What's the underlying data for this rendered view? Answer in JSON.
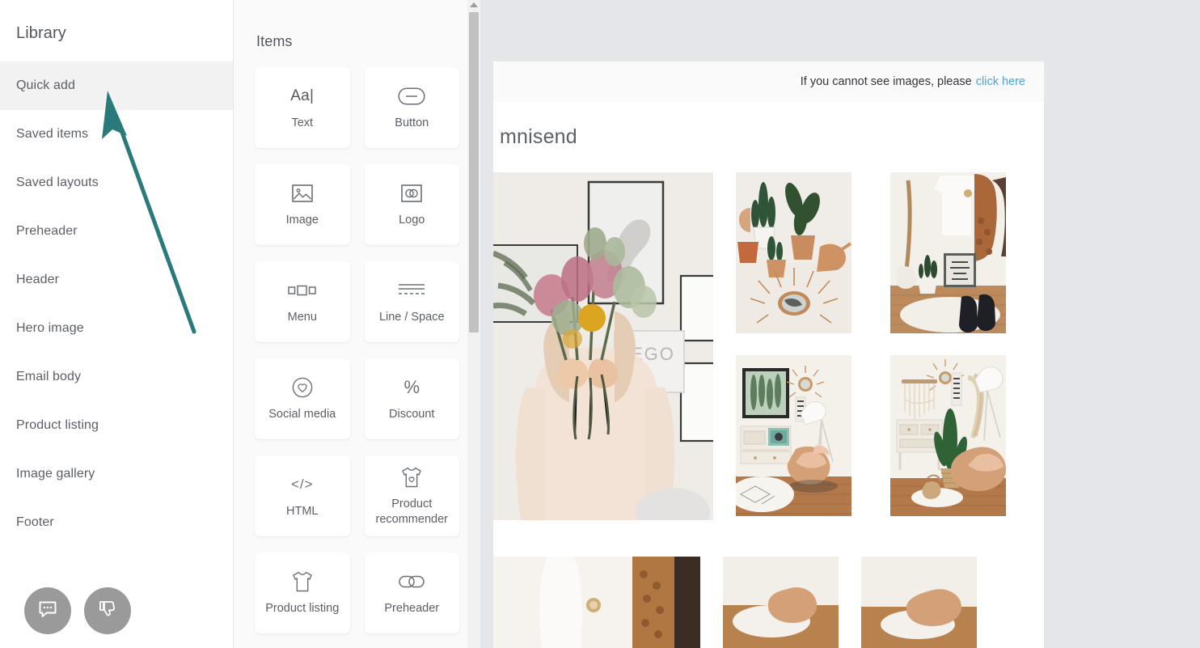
{
  "sidebar": {
    "title": "Library",
    "items": [
      {
        "label": "Quick add",
        "active": true
      },
      {
        "label": "Saved items",
        "active": false
      },
      {
        "label": "Saved layouts",
        "active": false
      },
      {
        "label": "Preheader",
        "active": false
      },
      {
        "label": "Header",
        "active": false
      },
      {
        "label": "Hero image",
        "active": false
      },
      {
        "label": "Email body",
        "active": false
      },
      {
        "label": "Product listing",
        "active": false
      },
      {
        "label": "Image gallery",
        "active": false
      },
      {
        "label": "Footer",
        "active": false
      }
    ],
    "feedback": [
      {
        "name": "chat-bubble-icon",
        "label": "Chat"
      },
      {
        "name": "thumbs-down-icon",
        "label": "Thumbs down"
      }
    ]
  },
  "items_panel": {
    "title": "Items",
    "tiles": [
      {
        "label": "Text",
        "icon": "text-aa-icon",
        "glyph": "Aa|"
      },
      {
        "label": "Button",
        "icon": "button-pill-icon",
        "glyph": ""
      },
      {
        "label": "Image",
        "icon": "image-picture-icon",
        "glyph": ""
      },
      {
        "label": "Logo",
        "icon": "logo-rings-icon",
        "glyph": ""
      },
      {
        "label": "Menu",
        "icon": "menu-boxes-icon",
        "glyph": ""
      },
      {
        "label": "Line / Space",
        "icon": "line-space-icon",
        "glyph": ""
      },
      {
        "label": "Social media",
        "icon": "social-heart-circle-icon",
        "glyph": ""
      },
      {
        "label": "Discount",
        "icon": "discount-percent-icon",
        "glyph": "%"
      },
      {
        "label": "HTML",
        "icon": "html-code-icon",
        "glyph": "</>"
      },
      {
        "label": "Product recommender",
        "icon": "tshirt-heart-icon",
        "glyph": ""
      },
      {
        "label": "Product listing",
        "icon": "tshirt-icon",
        "glyph": ""
      },
      {
        "label": "Preheader",
        "icon": "link-chain-icon",
        "glyph": ""
      }
    ]
  },
  "email_preview": {
    "preheader_text": "If you cannot see images, please",
    "preheader_link": "click here",
    "brand_logo": "mnisend",
    "photos": {
      "hero_alt": "woman holding dried flower bouquet",
      "grid_alts": [
        "cacti in copper pots with eye mirror",
        "clothing rack with boots and sign",
        "vintage record player console with rattan chair",
        "macrame wall hanging with cactus"
      ],
      "bottom_alts": [
        "white dress with knit sweater",
        "interior detail",
        "interior detail"
      ]
    }
  },
  "annotation": {
    "color": "#2b7a7b",
    "target": "Quick add"
  },
  "scrollbar": {
    "name": "items-panel-scrollbar"
  }
}
